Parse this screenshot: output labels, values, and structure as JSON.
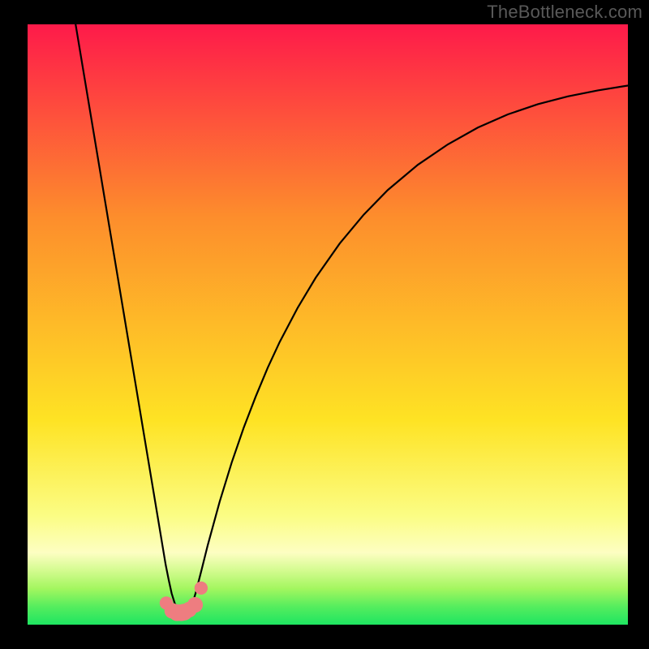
{
  "watermark": "TheBottleneck.com",
  "colors": {
    "frame": "#000000",
    "curve": "#000000",
    "marker_fill": "#ee7d80",
    "grad_top": "#fe1a4a",
    "grad_mid1": "#fd8d2c",
    "grad_mid2": "#fee324",
    "grad_low": "#fbfd85",
    "grad_green_top": "#a3f65f",
    "grad_green_bottom": "#1ee561"
  },
  "chart_data": {
    "type": "line",
    "title": "",
    "xlabel": "",
    "ylabel": "",
    "xlim": [
      0,
      100
    ],
    "ylim": [
      0,
      100
    ],
    "series": [
      {
        "name": "bottleneck-curve",
        "x": [
          8,
          9,
          10,
          11,
          12,
          13,
          14,
          15,
          16,
          17,
          18,
          19,
          20,
          21,
          22,
          22.5,
          23,
          23.5,
          24,
          24.5,
          25,
          25.5,
          26,
          26.5,
          27,
          27.5,
          28,
          29,
          30,
          32,
          34,
          36,
          38,
          40,
          42,
          45,
          48,
          52,
          56,
          60,
          65,
          70,
          75,
          80,
          85,
          90,
          95,
          100
        ],
        "y": [
          100,
          94,
          88,
          82,
          76,
          70,
          64,
          58,
          52,
          46,
          40,
          34,
          28,
          22,
          16,
          13,
          10,
          7.5,
          5.2,
          3.6,
          2.6,
          2.1,
          1.9,
          2.1,
          2.6,
          3.6,
          5.3,
          9.2,
          13.2,
          20.5,
          27,
          32.8,
          38,
          42.8,
          47.1,
          52.8,
          57.8,
          63.5,
          68.3,
          72.4,
          76.6,
          80,
          82.8,
          85,
          86.7,
          88,
          89,
          89.8
        ]
      }
    ],
    "markers": {
      "name": "bottom-cluster",
      "x": [
        23.1,
        24.1,
        24.9,
        25.6,
        26.1,
        26.9,
        27.9,
        28.9
      ],
      "y": [
        3.6,
        2.3,
        2.0,
        2.0,
        2.1,
        2.5,
        3.3,
        6.1
      ],
      "r": [
        1.1,
        1.3,
        1.4,
        1.4,
        1.4,
        1.3,
        1.3,
        1.1
      ]
    },
    "gradient_stops_pct": [
      0,
      32,
      66,
      82,
      88,
      91,
      94,
      97,
      100
    ]
  }
}
